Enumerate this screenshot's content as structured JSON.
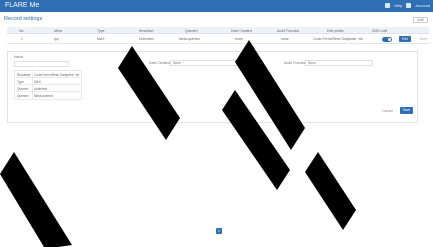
{
  "header": {
    "brand": "FLARE Me",
    "actions": [
      "Help",
      "Account"
    ]
  },
  "page": {
    "title": "Record settings",
    "add_label": "Add"
  },
  "table": {
    "columns": [
      "No.",
      "Meta",
      "Type",
      "Resultset",
      "Queried",
      "Date Created",
      "Audit Function",
      "Edit profile",
      "SMS notif"
    ],
    "rows": [
      {
        "no": "1",
        "meta": "typ",
        "type": "MAX",
        "resultset": "Unlimited",
        "queried": "Meta-queried",
        "date_created": "none",
        "audit": "none",
        "edit_profile": "Code-Ferns/Rese Dailywise, wk",
        "enabled": true,
        "edit_label": "Edit",
        "more_label": "⋯ More"
      }
    ]
  },
  "detail": {
    "name_label": "Name",
    "name_placeholder": "",
    "date_created_label": "Date Created",
    "date_created_value": "None",
    "audit_label": "Audit Function",
    "audit_value": "None",
    "properties": [
      {
        "key": "Resultset",
        "value": "Code-Ferns/Rese Dailywise, wk"
      },
      {
        "key": "Type",
        "value": "MAX"
      },
      {
        "key": "Queried",
        "value": "Unlimited"
      },
      {
        "key": "Queried",
        "value": "Meta-queried"
      }
    ],
    "cancel_label": "Cancel",
    "save_label": "Save"
  },
  "pagination": {
    "current": "1"
  },
  "colors": {
    "primary": "#2f6fb3",
    "header_bg": "#edf2f8",
    "watermark": "#000000"
  }
}
